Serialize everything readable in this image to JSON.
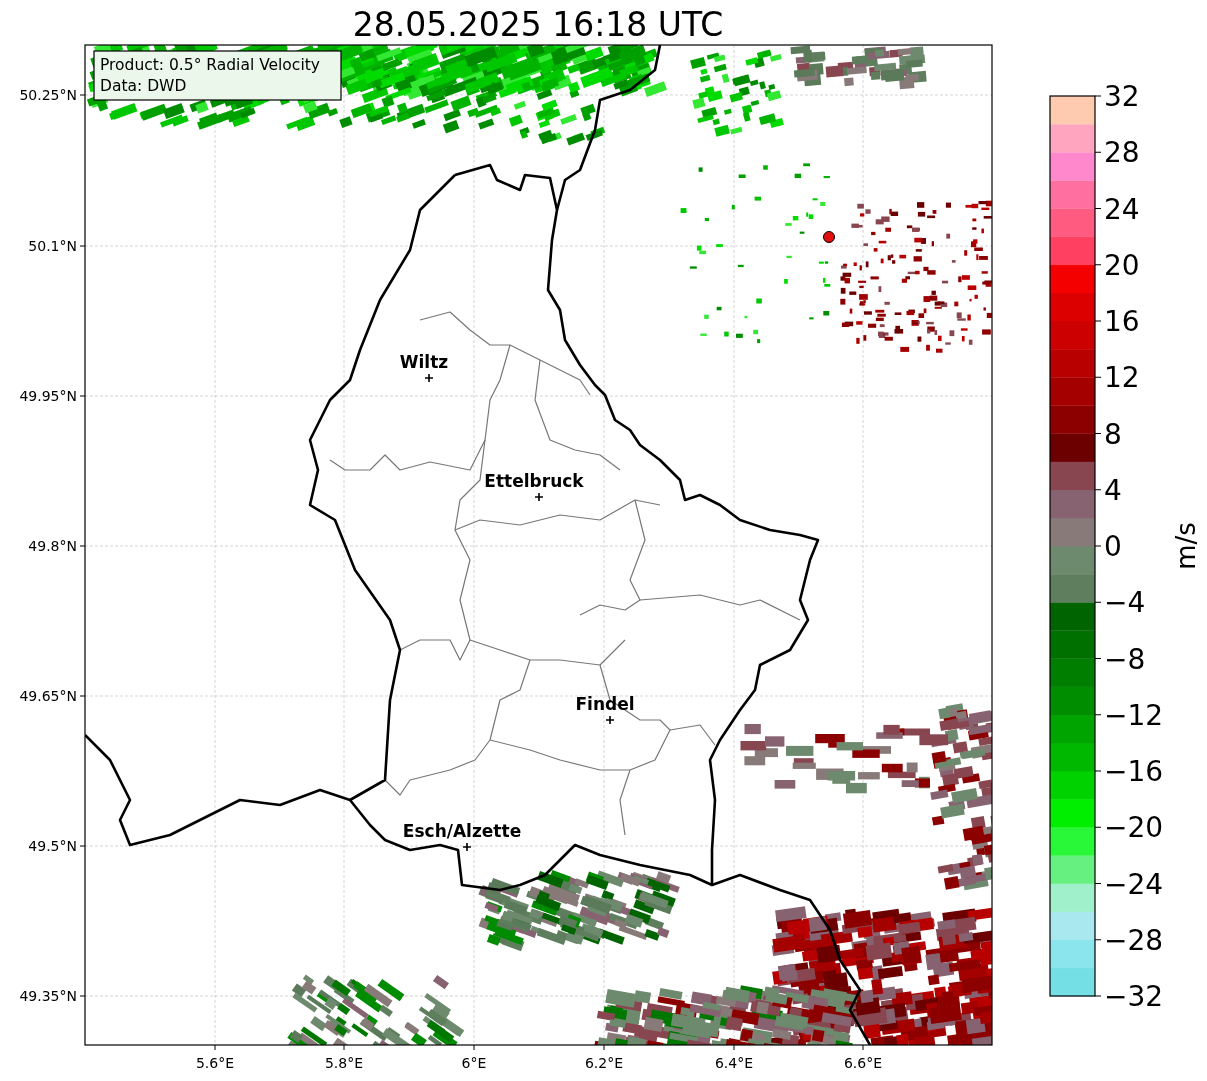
{
  "title": "28.05.2025 16:18 UTC",
  "map": {
    "info_lines": [
      "Product: 0.5° Radial Velocity",
      "Data: DWD"
    ],
    "yticks": [
      "50.25°N",
      "50.1°N",
      "49.95°N",
      "49.8°N",
      "49.65°N",
      "49.5°N",
      "49.35°N"
    ],
    "xticks": [
      "5.6°E",
      "5.8°E",
      "6°E",
      "6.2°E",
      "6.4°E",
      "6.6°E"
    ],
    "cities": [
      {
        "name": "Wiltz"
      },
      {
        "name": "Ettelbruck"
      },
      {
        "name": "Findel"
      },
      {
        "name": "Esch/Alzette"
      }
    ]
  },
  "colorbar": {
    "label": "m/s",
    "ticks": [
      "32",
      "28",
      "24",
      "20",
      "16",
      "12",
      "8",
      "4",
      "0",
      "−4",
      "−8",
      "−12",
      "−16",
      "−20",
      "−24",
      "−28",
      "−32"
    ],
    "segments": [
      {
        "color": "#74e0e6"
      },
      {
        "color": "#8ae6ec"
      },
      {
        "color": "#a8e8ee"
      },
      {
        "color": "#a0f0cc"
      },
      {
        "color": "#66f080"
      },
      {
        "color": "#28f838"
      },
      {
        "color": "#00ee00"
      },
      {
        "color": "#00d200"
      },
      {
        "color": "#00b800"
      },
      {
        "color": "#00a400"
      },
      {
        "color": "#008e00"
      },
      {
        "color": "#007e00"
      },
      {
        "color": "#007000"
      },
      {
        "color": "#006400"
      },
      {
        "color": "#5e7e5e"
      },
      {
        "color": "#6e8a6e"
      },
      {
        "color": "#887a78"
      },
      {
        "color": "#876270"
      },
      {
        "color": "#884650"
      },
      {
        "color": "#6c0000"
      },
      {
        "color": "#8c0000"
      },
      {
        "color": "#a40000"
      },
      {
        "color": "#b80000"
      },
      {
        "color": "#cc0000"
      },
      {
        "color": "#dc0000"
      },
      {
        "color": "#f50000"
      },
      {
        "color": "#ff4060"
      },
      {
        "color": "#ff5a80"
      },
      {
        "color": "#ff70a0"
      },
      {
        "color": "#ff88cc"
      },
      {
        "color": "#ffa5c0"
      },
      {
        "color": "#ffcbb0"
      }
    ]
  }
}
